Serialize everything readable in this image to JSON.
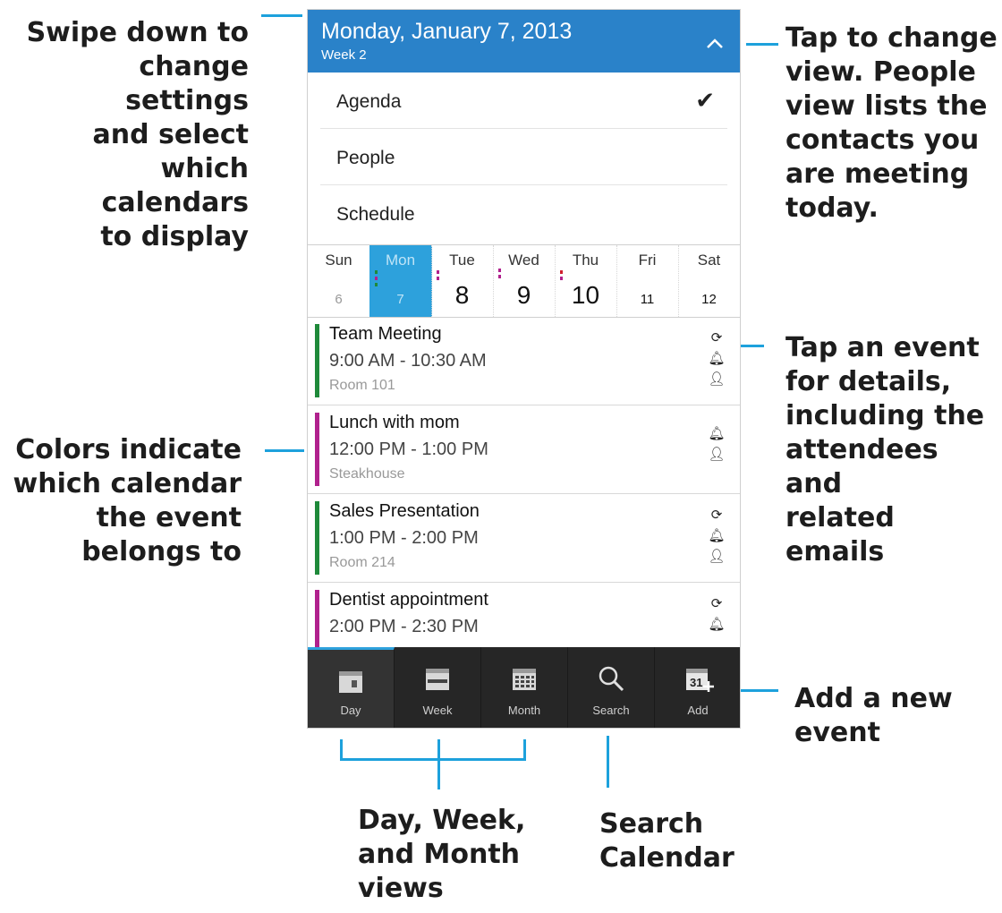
{
  "callouts": {
    "swipe": "Swipe down to\nchange settings\nand select\nwhich calendars\nto display",
    "tap_view": "Tap to change\nview. People\nview lists the\ncontacts you\nare meeting\ntoday.",
    "tap_event": "Tap an event\nfor details,\nincluding the\nattendees and\nrelated emails",
    "colors": "Colors indicate\nwhich calendar\nthe event\nbelongs to",
    "add_event": "Add a new\nevent",
    "views": "Day, Week,\nand Month\nviews",
    "search": "Search\nCalendar"
  },
  "header": {
    "date": "Monday, January 7, 2013",
    "week": "Week 2",
    "collapse_icon": "chevron-up-icon"
  },
  "view_menu": {
    "items": [
      {
        "label": "Agenda",
        "checked": true
      },
      {
        "label": "People",
        "checked": false
      },
      {
        "label": "Schedule",
        "checked": false
      }
    ],
    "check_glyph": "✔"
  },
  "week": {
    "days": [
      {
        "name": "Sun",
        "num": "6"
      },
      {
        "name": "Mon",
        "num": "7"
      },
      {
        "name": "Tue",
        "num": "8"
      },
      {
        "name": "Wed",
        "num": "9"
      },
      {
        "name": "Thu",
        "num": "10"
      },
      {
        "name": "Fri",
        "num": "11"
      },
      {
        "name": "Sat",
        "num": "12"
      }
    ],
    "selected_index": 1
  },
  "events": [
    {
      "title": "Team Meeting",
      "time": "9:00 AM - 10:30 AM",
      "location": "Room 101",
      "color": "#1f8a3a",
      "recurring": true
    },
    {
      "title": "Lunch with mom",
      "time": "12:00 PM - 1:00 PM",
      "location": "Steakhouse",
      "color": "#b0218d",
      "recurring": false
    },
    {
      "title": "Sales Presentation",
      "time": "1:00 PM - 2:00 PM",
      "location": "Room 214",
      "color": "#1f8a3a",
      "recurring": true
    },
    {
      "title": "Dentist appointment",
      "time": "2:00 PM - 2:30 PM",
      "location": "",
      "color": "#b0218d",
      "recurring": true
    }
  ],
  "toolbar": {
    "day": "Day",
    "week": "Week",
    "month": "Month",
    "search": "Search",
    "add": "Add",
    "add_icon_text": "31",
    "active": "day"
  },
  "colors": {
    "header_blue": "#2a82c9",
    "selected_day": "#2da1dc",
    "leader_blue": "#1da1dc",
    "toolbar_dark": "#262626",
    "green_calendar": "#1f8a3a",
    "magenta_calendar": "#b0218d"
  }
}
